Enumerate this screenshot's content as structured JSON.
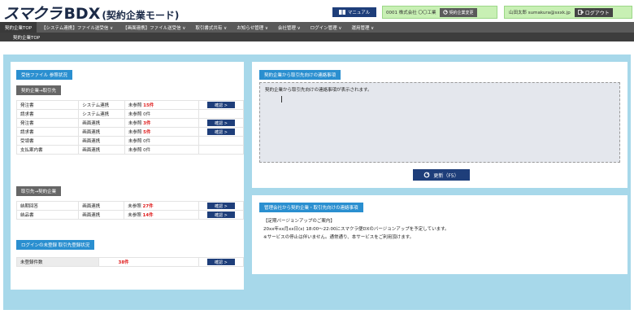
{
  "header": {
    "brand": "スマクラ",
    "product": "BDX",
    "mode": "(契約企業モード)",
    "manual_label": "マニュアル",
    "company": "0001 株式会社 〇〇工業",
    "change_company_label": "契約企業変更",
    "user": "山田太郎 sumakura@sxxk.jp",
    "logout_label": "ログアウト"
  },
  "nav": {
    "items": [
      {
        "label": "契約企業TOP"
      },
      {
        "label": "【システム連携】ファイル送受信 ∨"
      },
      {
        "label": "【画面連携】ファイル送受信 ∨"
      },
      {
        "label": "取引書式共有 ∨"
      },
      {
        "label": "お知らせ管理 ∨"
      },
      {
        "label": "会社管理 ∨"
      },
      {
        "label": "ログイン管理 ∨"
      },
      {
        "label": "運用管理 ∨"
      }
    ],
    "sub_label": "契約企業TOP"
  },
  "left": {
    "title": "受信ファイル 参照状況",
    "group1_label": "契約企業→取引先",
    "group1_rows": [
      {
        "doc": "発注書",
        "type": "システム連携",
        "status": "未参照",
        "count": "15件",
        "has_button": true
      },
      {
        "doc": "請求書",
        "type": "システム連携",
        "status": "未参照",
        "count": "0件",
        "has_button": false
      },
      {
        "doc": "発注書",
        "type": "画面連携",
        "status": "未参照",
        "count": "3件",
        "has_button": true
      },
      {
        "doc": "請求書",
        "type": "画面連携",
        "status": "未参照",
        "count": "5件",
        "has_button": true
      },
      {
        "doc": "受領書",
        "type": "画面連携",
        "status": "未参照",
        "count": "0件",
        "has_button": false
      },
      {
        "doc": "支払案内書",
        "type": "画面連携",
        "status": "未参照",
        "count": "0件",
        "has_button": false
      }
    ],
    "group2_label": "取引先→契約企業",
    "group2_rows": [
      {
        "doc": "納期回答",
        "type": "画面連携",
        "status": "未参照",
        "count": "27件",
        "has_button": true
      },
      {
        "doc": "納品書",
        "type": "画面連携",
        "status": "未参照",
        "count": "14件",
        "has_button": true
      }
    ],
    "login_title": "ログインの未登録 取引先登録状況",
    "unregistered_label": "未登録件数",
    "unregistered_count": "38件",
    "confirm_label": "確認 >"
  },
  "right_top": {
    "title": "契約企業から取引先向けの連絡事項",
    "body": "契約企業から取引先向けの連絡事項が表示されます。",
    "refresh_label": "更新（F5）"
  },
  "right_bottom": {
    "title": "管理会社から契約企業・取引先向けの連絡事項",
    "line1": "【定期バージョンアップのご案内】",
    "line2": "20xx年xx月xx日(x) 18:00～22:00にスマクラ便DXのバージョンアップを予定しています。",
    "line3": "※サービスの停止は伴いません。通常通り、本サービスをご利用頂けます。"
  }
}
